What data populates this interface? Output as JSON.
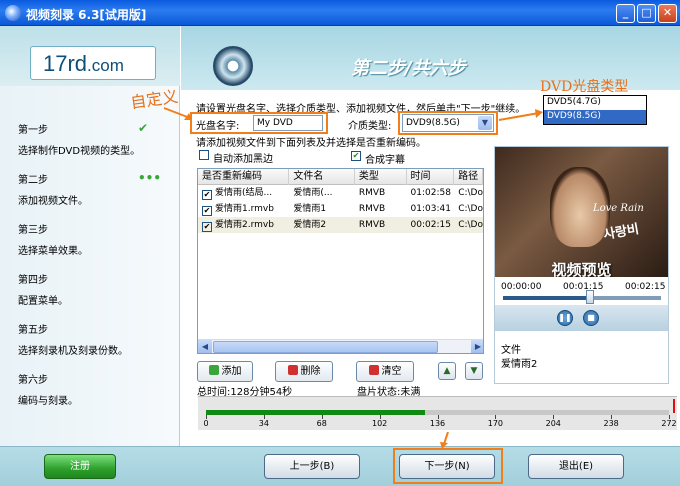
{
  "window": {
    "title": "视频刻录 6.3[试用版]",
    "min_label": "_",
    "max_label": "□",
    "close_label": "✕"
  },
  "logo": {
    "main": "17rd",
    "suffix": ".com"
  },
  "header": {
    "title": "第二步/共六步"
  },
  "steps": [
    {
      "title": "第一步",
      "desc": "选择制作DVD视频的类型。",
      "mark": "✔"
    },
    {
      "title": "第二步",
      "desc": "添加视频文件。",
      "mark": "•••"
    },
    {
      "title": "第三步",
      "desc": "选择菜单效果。",
      "mark": ""
    },
    {
      "title": "第四步",
      "desc": "配置菜单。",
      "mark": ""
    },
    {
      "title": "第五步",
      "desc": "选择刻录机及刻录份数。",
      "mark": ""
    },
    {
      "title": "第六步",
      "desc": "编码与刻录。",
      "mark": ""
    }
  ],
  "form": {
    "instruction": "请设置光盘名字、选择介质类型、添加视频文件，然后单击\"下一步\"继续。",
    "disc_name_label": "光盘名字:",
    "disc_name_value": "My DVD",
    "media_type_label": "介质类型:",
    "media_type_value": "DVD9(8.5G)",
    "media_options": [
      "DVD5(4.7G)",
      "DVD9(8.5G)"
    ],
    "add_instruction": "请添加视频文件到下面列表及并选择是否重新编码。",
    "auto_black_label": "自动添加黑边",
    "subtitle_label": "合成字幕"
  },
  "annotations": {
    "custom": "自定义",
    "dvd_type": "DVD光盘类型",
    "preview": "视频预览"
  },
  "table": {
    "headers": [
      "是否重新编码",
      "文件名",
      "类型",
      "时间",
      "路径"
    ],
    "rows": [
      {
        "name1": "爱情雨(结局...",
        "name2": "爱情雨(...",
        "type": "RMVB",
        "time": "01:02:58",
        "path": "C:\\Do"
      },
      {
        "name1": "爱情雨1.rmvb",
        "name2": "爱情雨1",
        "type": "RMVB",
        "time": "01:03:41",
        "path": "C:\\Do"
      },
      {
        "name1": "爱情雨2.rmvb",
        "name2": "爱情雨2",
        "type": "RMVB",
        "time": "00:02:15",
        "path": "C:\\Do"
      }
    ]
  },
  "preview": {
    "love_text": "Love Rain",
    "kr_text": "사랑비",
    "time_start": "00:00:00",
    "time_current": "00:01:15",
    "time_end": "00:02:15",
    "progress": 0.55,
    "file_label": "文件",
    "file_name": "爱情雨2"
  },
  "actions": {
    "add": "添加",
    "delete": "删除",
    "clear": "清空"
  },
  "status": {
    "total_time": "总时间:128分钟54秒",
    "disc_state": "盘片状态:未满"
  },
  "ruler": {
    "labels": [
      "0",
      "34",
      "68",
      "102",
      "136",
      "170",
      "204",
      "238",
      "272"
    ],
    "max": 272,
    "fill_value": 128.9
  },
  "bottom": {
    "register": "注册",
    "prev": "上一步(B)",
    "next": "下一步(N)",
    "exit": "退出(E)"
  }
}
